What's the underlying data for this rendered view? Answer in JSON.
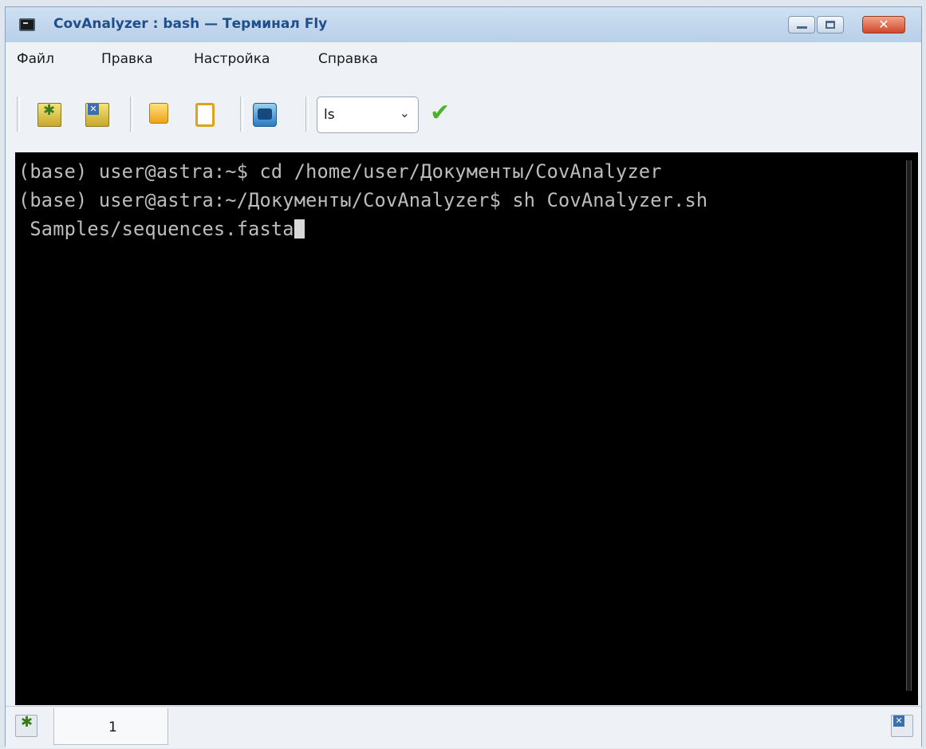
{
  "window": {
    "title": "CovAnalyzer : bash — Терминал Fly",
    "close_glyph": "✕"
  },
  "menu": {
    "items": [
      "Файл",
      "Правка",
      "Настройка",
      "Справка"
    ]
  },
  "toolbar": {
    "command_combo_value": "ls",
    "combo_arrow_glyph": "⌄",
    "run_glyph": "✔"
  },
  "terminal": {
    "lines": [
      "(base) user@astra:~$ cd /home/user/Документы/CovAnalyzer",
      "(base) user@astra:~/Документы/CovAnalyzer$ sh CovAnalyzer.sh",
      " Samples/sequences.fasta"
    ],
    "background_color": "#000000",
    "text_color": "#bdbdbd"
  },
  "tabs": [
    {
      "label": "1"
    }
  ]
}
